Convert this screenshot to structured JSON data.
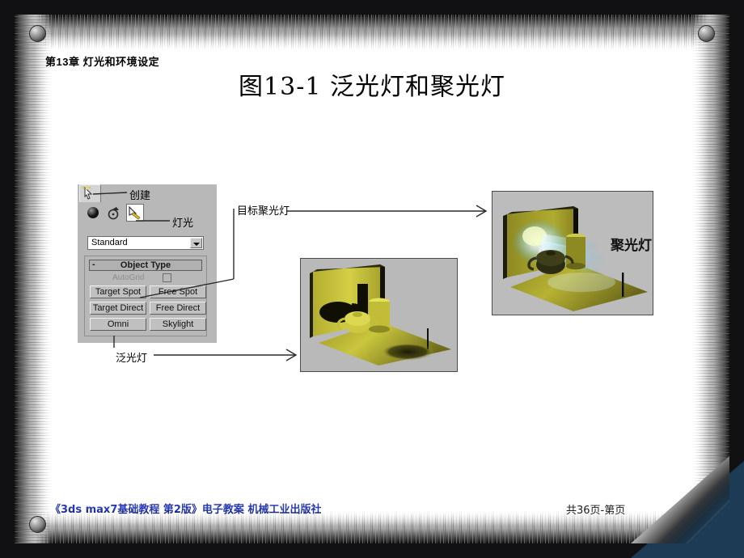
{
  "slide": {
    "chapter_heading": "第13章  灯光和环境设定",
    "title": "图13-1 泛光灯和聚光灯"
  },
  "command_panel": {
    "create_tab_icon": "create-arrow-icon",
    "category_icons": [
      {
        "name": "geometry-sphere-icon",
        "selected": false
      },
      {
        "name": "shapes-icon",
        "selected": false
      },
      {
        "name": "lights-icon",
        "selected": true
      }
    ],
    "dropdown": {
      "value": "Standard",
      "arrow_icon": "chevron-down-icon"
    },
    "rollout": {
      "collapse_glyph": "-",
      "title": "Object Type",
      "autogrid_label": "AutoGrid",
      "autogrid_checked": false,
      "buttons": [
        {
          "label": "Target Spot",
          "col": "left"
        },
        {
          "label": "Free Spot",
          "col": "right"
        },
        {
          "label": "Target Direct",
          "col": "left"
        },
        {
          "label": "Free Direct",
          "col": "right"
        },
        {
          "label": "Omni",
          "col": "left"
        },
        {
          "label": "Skylight",
          "col": "right"
        }
      ]
    }
  },
  "annotations": {
    "create": "创建",
    "light": "灯光",
    "target_spot": "目标聚光灯",
    "omni": "泛光灯"
  },
  "images": {
    "left_caption": "",
    "right_inline_label": "聚光灯"
  },
  "footer": {
    "left": "《3ds max7基础教程 第2版》电子教案 机械工业出版社",
    "right": "共36页-第页"
  },
  "colors": {
    "background": "#111113",
    "paper": "#ffffff",
    "navy_corner": "#1d3b54",
    "footer_blue": "#1b2c8a",
    "panel_grey": "#b8b8b8",
    "scene_yellow": "#c8c33a"
  }
}
